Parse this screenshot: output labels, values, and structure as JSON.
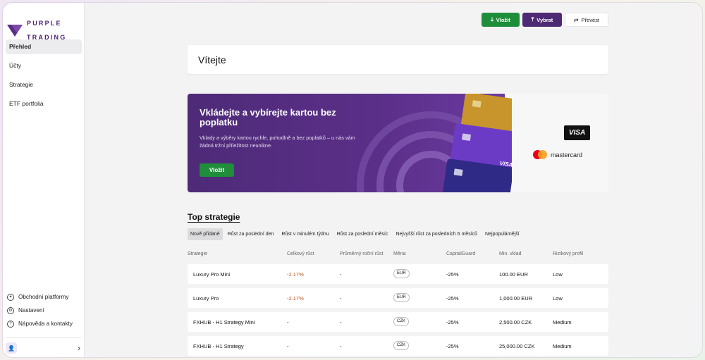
{
  "brand": {
    "line1": "PURPLE",
    "line2": "TRADING",
    "color": "#4b1f6f"
  },
  "sidebar": {
    "items": [
      {
        "label": "Přehled",
        "active": true
      },
      {
        "label": "Účty"
      },
      {
        "label": "Strategie"
      },
      {
        "label": "ETF portfolia"
      }
    ],
    "bottom": [
      {
        "label": "Obchodní platformy",
        "icon": "compass-icon"
      },
      {
        "label": "Nastavení",
        "icon": "gear-icon"
      },
      {
        "label": "Nápověda a kontakty",
        "icon": "help-icon"
      }
    ]
  },
  "header": {
    "deposit_label": "Vložit",
    "withdraw_label": "Vybrat",
    "transfer_label": "Převést"
  },
  "welcome": {
    "title": "Vítejte"
  },
  "banner": {
    "title": "Vkládejte a vybírejte kartou bez poplatku",
    "text": "Vklady a výběry kartou rychle, pohodlně a bez poplatků – u nás vám žádná tržní příležitost neunikne.",
    "button": "Vložit",
    "visa": "VISA",
    "mastercard": "mastercard"
  },
  "strategies": {
    "title": "Top strategie",
    "filters": [
      {
        "label": "Nově přidané",
        "active": true
      },
      {
        "label": "Růst za poslední den"
      },
      {
        "label": "Růst v minulém týdnu"
      },
      {
        "label": "Růst za poslední měsíc"
      },
      {
        "label": "Nejvyšší růst za posledních 6 měsíců"
      },
      {
        "label": "Nejpopulárnější"
      }
    ],
    "columns": [
      "Strategie",
      "Celkový růst",
      "Průměrný roční růst",
      "Měna",
      "CapitalGuard",
      "Min. vklad",
      "Rizikový profil"
    ],
    "rows": [
      {
        "name": "Luxury Pro Mini",
        "total": "-2.17%",
        "avg": "-",
        "currency": "EUR",
        "guard": "-25%",
        "min": "100.00 EUR",
        "risk": "Low"
      },
      {
        "name": "Luxury Pro",
        "total": "-2.17%",
        "avg": "-",
        "currency": "EUR",
        "guard": "-25%",
        "min": "1,000.00 EUR",
        "risk": "Low"
      },
      {
        "name": "FXHUB - H1 Strategy Mini",
        "total": "-",
        "avg": "-",
        "currency": "CZK",
        "guard": "-25%",
        "min": "2,500.00 CZK",
        "risk": "Medium"
      },
      {
        "name": "FXHUB - H1 Strategy",
        "total": "-",
        "avg": "-",
        "currency": "CZK",
        "guard": "-25%",
        "min": "25,000.00 CZK",
        "risk": "Medium"
      }
    ]
  },
  "colors": {
    "green": "#1f8e3a",
    "purple": "#4d2a73",
    "negative": "#c0531c"
  }
}
